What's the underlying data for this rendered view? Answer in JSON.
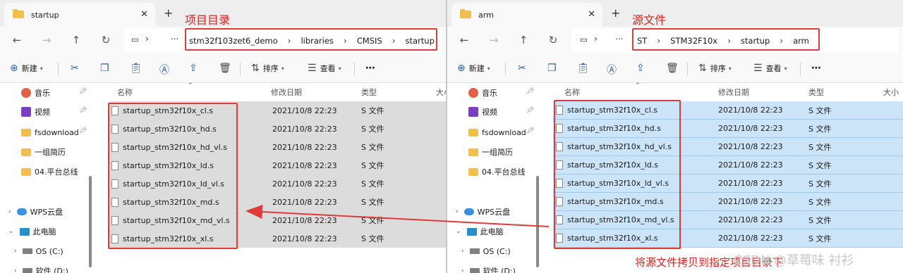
{
  "left": {
    "tab_title": "startup",
    "breadcrumbs": [
      "stm32f103zet6_demo",
      "libraries",
      "CMSIS",
      "startup"
    ],
    "annotation": "项目目录",
    "toolbar": {
      "new": "新建",
      "sort": "排序",
      "view": "查看"
    },
    "nav": [
      {
        "label": "音乐",
        "icon": "music-icon"
      },
      {
        "label": "视频",
        "icon": "video-icon"
      },
      {
        "label": "fsdownload",
        "icon": "folder-icon"
      },
      {
        "label": "一组简历",
        "icon": "folder-icon"
      },
      {
        "label": "04.平台总线",
        "icon": "folder-icon"
      },
      {
        "label": "WPS云盘",
        "icon": "cloud-icon"
      },
      {
        "label": "此电脑",
        "icon": "computer-icon"
      },
      {
        "label": "OS (C:)",
        "icon": "drive-icon"
      },
      {
        "label": "软件 (D:)",
        "icon": "drive-icon"
      }
    ],
    "columns": {
      "name": "名称",
      "modified": "修改日期",
      "type": "类型",
      "size": "大小"
    }
  },
  "right": {
    "tab_title": "arm",
    "breadcrumbs": [
      "ST",
      "STM32F10x",
      "startup",
      "arm"
    ],
    "annotation": "源文件",
    "toolbar": {
      "new": "新建",
      "sort": "排序",
      "view": "查看"
    },
    "nav": [
      {
        "label": "音乐",
        "icon": "music-icon"
      },
      {
        "label": "视频",
        "icon": "video-icon"
      },
      {
        "label": "fsdownload",
        "icon": "folder-icon"
      },
      {
        "label": "一组简历",
        "icon": "folder-icon"
      },
      {
        "label": "04.平台总线",
        "icon": "folder-icon"
      },
      {
        "label": "WPS云盘",
        "icon": "cloud-icon"
      },
      {
        "label": "此电脑",
        "icon": "computer-icon"
      },
      {
        "label": "OS (C:)",
        "icon": "drive-icon"
      },
      {
        "label": "软件 (D:)",
        "icon": "drive-icon"
      }
    ],
    "columns": {
      "name": "名称",
      "modified": "修改日期",
      "type": "类型",
      "size": "大小"
    }
  },
  "files": [
    {
      "name": "startup_stm32f10x_cl.s",
      "modified": "2021/10/8 22:23",
      "type": "S 文件"
    },
    {
      "name": "startup_stm32f10x_hd.s",
      "modified": "2021/10/8 22:23",
      "type": "S 文件"
    },
    {
      "name": "startup_stm32f10x_hd_vl.s",
      "modified": "2021/10/8 22:23",
      "type": "S 文件"
    },
    {
      "name": "startup_stm32f10x_ld.s",
      "modified": "2021/10/8 22:23",
      "type": "S 文件"
    },
    {
      "name": "startup_stm32f10x_ld_vl.s",
      "modified": "2021/10/8 22:23",
      "type": "S 文件"
    },
    {
      "name": "startup_stm32f10x_md.s",
      "modified": "2021/10/8 22:23",
      "type": "S 文件"
    },
    {
      "name": "startup_stm32f10x_md_vl.s",
      "modified": "2021/10/8 22:23",
      "type": "S 文件"
    },
    {
      "name": "startup_stm32f10x_xl.s",
      "modified": "2021/10/8 22:23",
      "type": "S 文件"
    }
  ],
  "bottom_annotation": "将源文件拷贝到指定项目目录下",
  "watermark": "CSDN @草莓味  衬衫",
  "colors": {
    "annotation_red": "#e02020",
    "selection_blue": "#cce4f7",
    "selection_gray": "#dcdcdc"
  }
}
